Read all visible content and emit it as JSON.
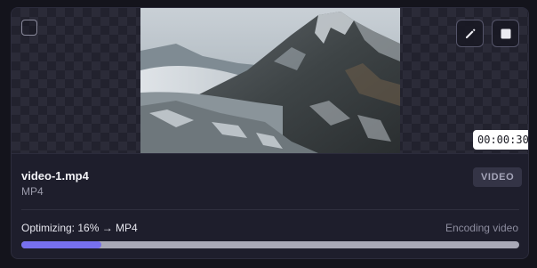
{
  "item": {
    "filename": "video-1.mp4",
    "format": "MP4",
    "type_badge": "VIDEO",
    "duration": "00:00:30"
  },
  "progress": {
    "label": "Optimizing: 16% → MP4",
    "status": "Encoding video",
    "fraction": 0.16
  },
  "colors": {
    "accent": "#7770ee",
    "card_bg": "#1e1e2c",
    "track": "#a8a8b6"
  },
  "icons": {
    "select": "checkbox-icon",
    "edit": "pencil-icon",
    "stop": "stop-icon"
  }
}
